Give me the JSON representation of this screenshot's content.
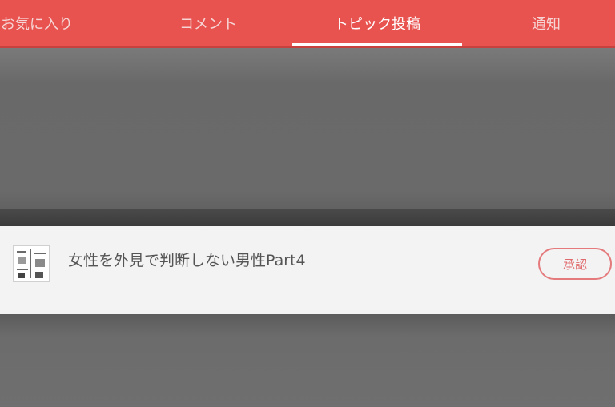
{
  "tabs": [
    {
      "label": "お気に入り",
      "active": false
    },
    {
      "label": "コメント",
      "active": false
    },
    {
      "label": "トピック投稿",
      "active": true
    },
    {
      "label": "通知",
      "active": false
    }
  ],
  "topic": {
    "title": "女性を外見で判断しない男性Part4",
    "approve_label": "承認",
    "thumbnail_icon": "manga-thumbnail"
  },
  "colors": {
    "header": "#e8524f",
    "approve_border": "#e57a7d",
    "row_background": "#f3f3f3"
  }
}
